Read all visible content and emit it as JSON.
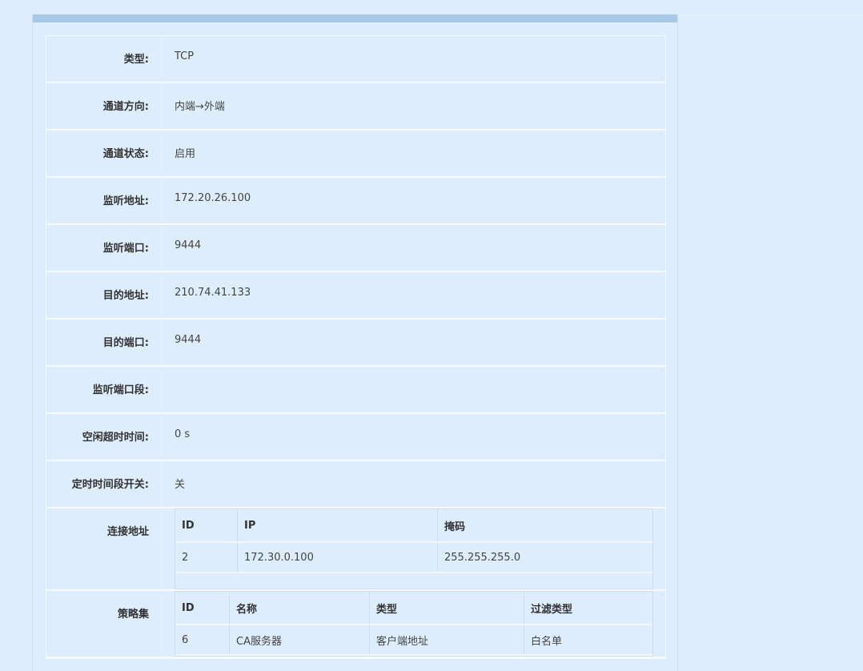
{
  "details": [
    {
      "label": "类型:",
      "value": "TCP"
    },
    {
      "label": "通道方向:",
      "value": "内端→外端"
    },
    {
      "label": "通道状态:",
      "value": "启用"
    },
    {
      "label": "监听地址:",
      "value": "172.20.26.100"
    },
    {
      "label": "监听端口:",
      "value": "9444"
    },
    {
      "label": "目的地址:",
      "value": "210.74.41.133"
    },
    {
      "label": "目的端口:",
      "value": "9444"
    },
    {
      "label": "监听端口段:",
      "value": ""
    },
    {
      "label": "空闲超时时间:",
      "value": "0 s"
    },
    {
      "label": "定时时间段开关:",
      "value": "关"
    }
  ],
  "connection": {
    "label": "连接地址",
    "headers": [
      "ID",
      "IP",
      "掩码"
    ],
    "rows": [
      [
        "2",
        "172.30.0.100",
        "255.255.255.0"
      ]
    ]
  },
  "policy": {
    "label": "策略集",
    "headers": [
      "ID",
      "名称",
      "类型",
      "过滤类型"
    ],
    "rows": [
      [
        "6",
        "CA服务器",
        "客户端地址",
        "白名单"
      ]
    ]
  }
}
